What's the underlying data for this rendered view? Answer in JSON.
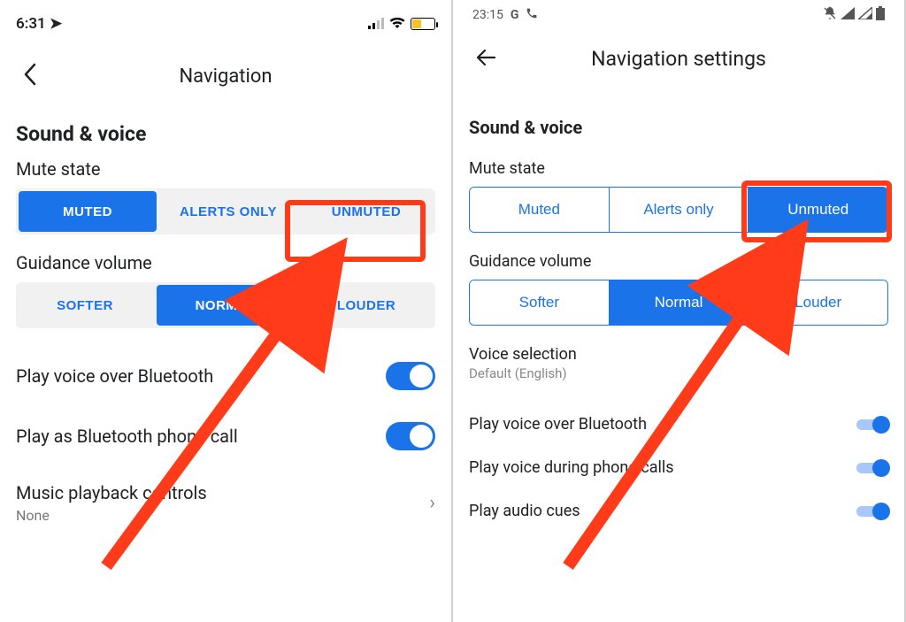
{
  "ios": {
    "status_time": "6:31",
    "nav_title": "Navigation",
    "section": "Sound & voice",
    "mute_label": "Mute state",
    "mute_options": [
      "MUTED",
      "ALERTS ONLY",
      "UNMUTED"
    ],
    "mute_selected": 0,
    "guidance_label": "Guidance volume",
    "guidance_options": [
      "SOFTER",
      "NORMAL",
      "LOUDER"
    ],
    "guidance_selected": 1,
    "toggle_bt": "Play voice over Bluetooth",
    "toggle_call": "Play as Bluetooth phone call",
    "music_label": "Music playback controls",
    "music_value": "None"
  },
  "android": {
    "status_time": "23:15",
    "nav_title": "Navigation settings",
    "section": "Sound & voice",
    "mute_label": "Mute state",
    "mute_options": [
      "Muted",
      "Alerts only",
      "Unmuted"
    ],
    "mute_selected": 2,
    "guidance_label": "Guidance volume",
    "guidance_options": [
      "Softer",
      "Normal",
      "Louder"
    ],
    "guidance_selected": 1,
    "voice_sel_label": "Voice selection",
    "voice_sel_value": "Default (English)",
    "toggle_bt": "Play voice over Bluetooth",
    "toggle_calls": "Play voice during phone calls",
    "toggle_cues": "Play audio cues"
  }
}
